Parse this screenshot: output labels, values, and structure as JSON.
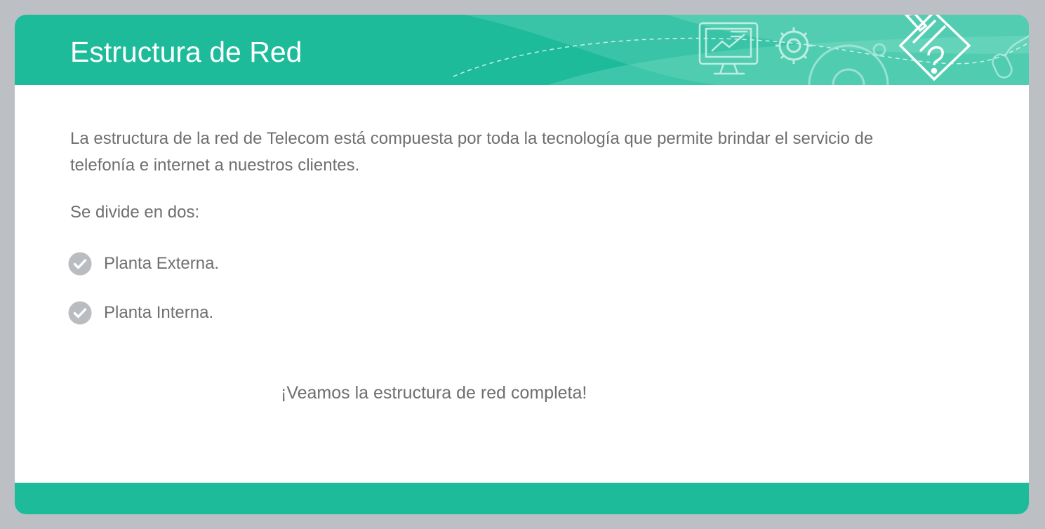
{
  "slide": {
    "title": "Estructura de Red",
    "intro": "La estructura de la red de Telecom está compuesta por toda la tecnología que permite brindar el servicio de telefonía e internet a nuestros clientes.",
    "subhead": "Se divide en dos:",
    "bullets": [
      {
        "label": "Planta Externa.",
        "icon": "check-circle-icon"
      },
      {
        "label": "Planta Interna.",
        "icon": "check-circle-icon"
      }
    ],
    "cta": "¡Veamos la estructura de red completa!"
  },
  "colors": {
    "accent": "#1dbb9a",
    "text": "#6f6f6f",
    "bullet_icon": "#b9bcc0",
    "frame": "#bcbfc3"
  },
  "header_icons": [
    "monitor-presentation-icon",
    "gear-icon",
    "large-gear-icon",
    "help-checklist-icon",
    "mouse-icon"
  ]
}
